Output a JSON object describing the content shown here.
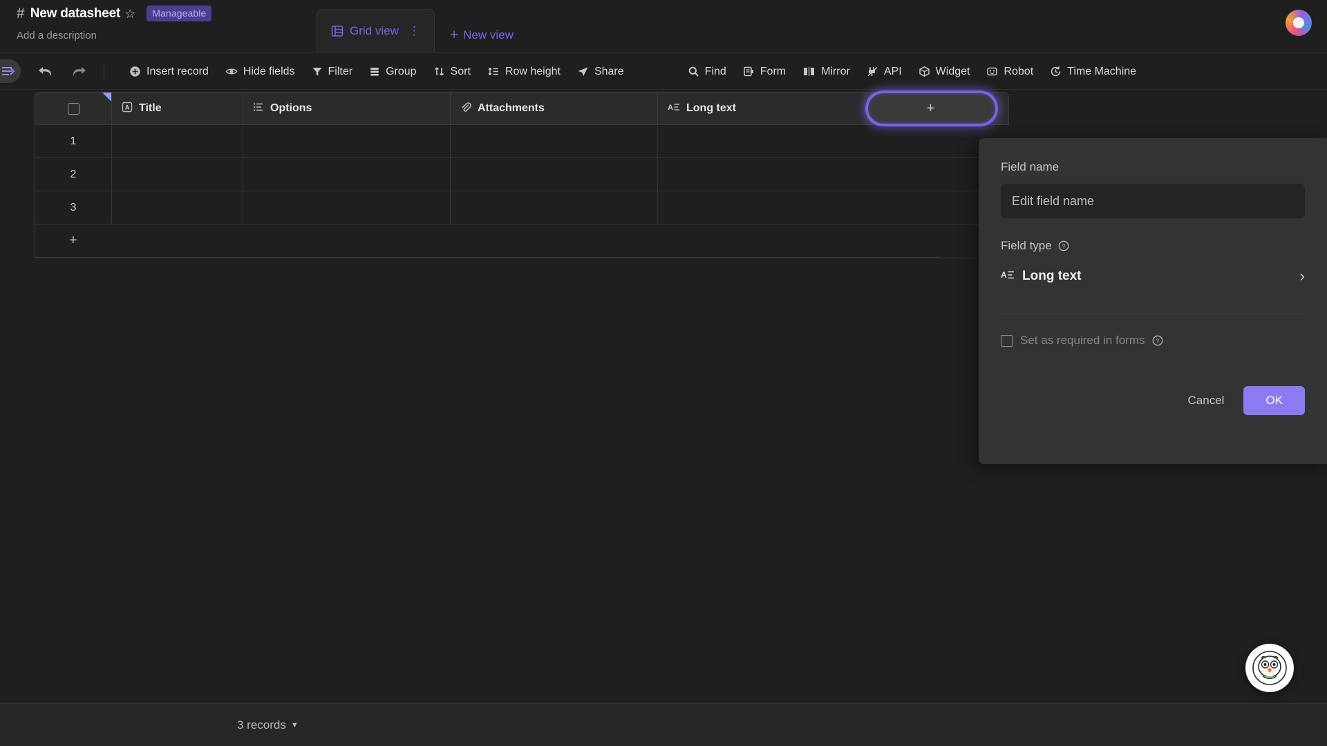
{
  "header": {
    "hash_icon": "hash-icon",
    "datasheet_name": "New datasheet",
    "star_icon": "star-icon",
    "badge": "Manageable",
    "description_placeholder": "Add a description",
    "avatar": "user-avatar"
  },
  "view_tabs": {
    "active_tab": "Grid view",
    "tab_icon": "grid-view-icon",
    "more_icon": "⋮",
    "new_view_label": "New view",
    "new_view_icon": "plus-icon"
  },
  "toolbar": {
    "sidebar_toggle_icon": "sidebar-collapse-icon",
    "undo_icon": "undo-icon",
    "redo_icon": "redo-icon",
    "left_items": [
      {
        "label": "Insert record",
        "icon": "plus-circle-icon"
      },
      {
        "label": "Hide fields",
        "icon": "eye-icon"
      },
      {
        "label": "Filter",
        "icon": "funnel-icon"
      },
      {
        "label": "Group",
        "icon": "group-icon"
      },
      {
        "label": "Sort",
        "icon": "sort-icon"
      },
      {
        "label": "Row height",
        "icon": "row-height-icon"
      },
      {
        "label": "Share",
        "icon": "share-icon"
      }
    ],
    "right_items": [
      {
        "label": "Find",
        "icon": "search-icon"
      },
      {
        "label": "Form",
        "icon": "form-icon"
      },
      {
        "label": "Mirror",
        "icon": "mirror-icon"
      },
      {
        "label": "API",
        "icon": "api-plug-icon"
      },
      {
        "label": "Widget",
        "icon": "widget-cube-icon"
      },
      {
        "label": "Robot",
        "icon": "robot-icon"
      },
      {
        "label": "Time Machine",
        "icon": "time-machine-icon"
      }
    ]
  },
  "grid": {
    "select_all_icon": "checkbox-icon",
    "columns": [
      {
        "label": "Title",
        "icon": "single-line-text-icon"
      },
      {
        "label": "Options",
        "icon": "select-options-icon"
      },
      {
        "label": "Attachments",
        "icon": "paperclip-icon"
      },
      {
        "label": "Long text",
        "icon": "long-text-icon"
      }
    ],
    "add_field_label": "+",
    "rows": [
      {
        "num": "1",
        "Title": "",
        "Options": "",
        "Attachments": "",
        "Long text": ""
      },
      {
        "num": "2",
        "Title": "",
        "Options": "",
        "Attachments": "",
        "Long text": ""
      },
      {
        "num": "3",
        "Title": "",
        "Options": "",
        "Attachments": "",
        "Long text": ""
      }
    ],
    "add_row_label": "+"
  },
  "field_panel": {
    "field_name_label": "Field name",
    "field_name_value": "",
    "field_name_placeholder": "Edit field name",
    "field_type_label": "Field type",
    "field_type_help_icon": "help-icon",
    "field_type_value": "Long text",
    "field_type_icon": "long-text-icon",
    "expand_icon": "chevron-right-icon",
    "required_label": "Set as required in forms",
    "required_checked": false,
    "required_help_icon": "help-icon",
    "cancel_label": "Cancel",
    "ok_label": "OK"
  },
  "bottom_bar": {
    "record_count": "3 records",
    "caret_icon": "caret-down-icon"
  },
  "mascot": {
    "name": "vika-mascot-icon"
  },
  "colors": {
    "accent": "#7b61e8",
    "ok_button": "#8b7bf0",
    "badge_bg": "#4a3f8f",
    "page_bg": "#1f1f1f",
    "panel_bg": "#333333"
  }
}
